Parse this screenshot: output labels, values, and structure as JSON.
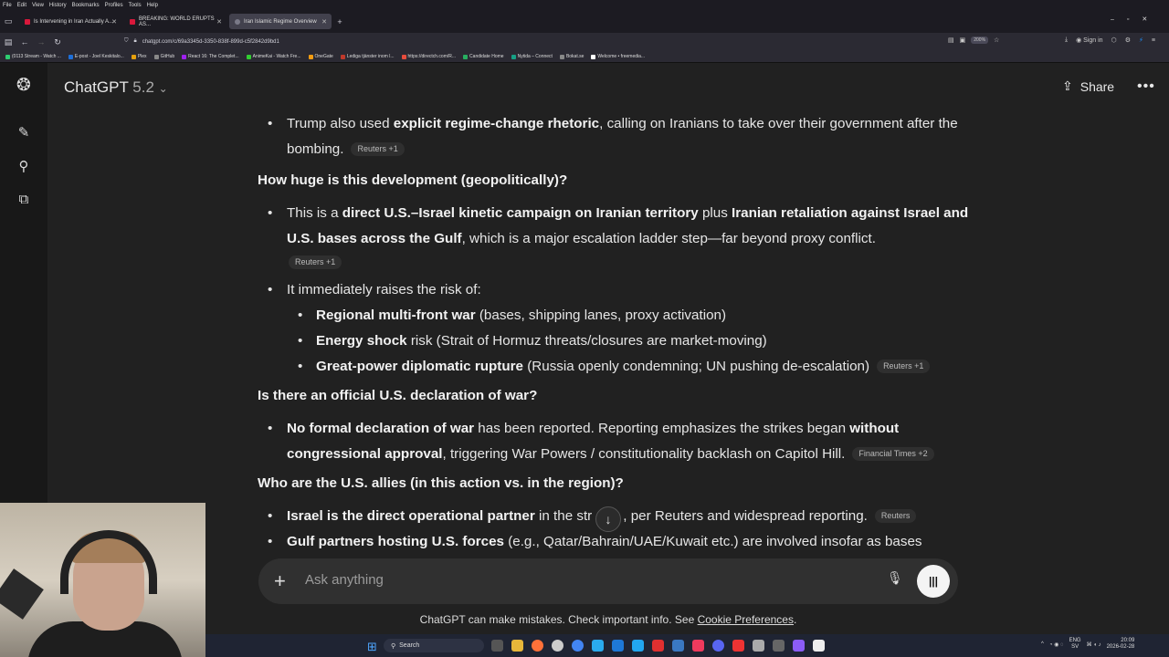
{
  "browser": {
    "menu": [
      "File",
      "Edit",
      "View",
      "History",
      "Bookmarks",
      "Profiles",
      "Tools",
      "Help"
    ],
    "tabs": [
      {
        "label": "Is Intervening in Iran Actually A...",
        "active": false
      },
      {
        "label": "BREAKING: WORLD ERUPTS AS...",
        "active": false
      },
      {
        "label": "Iran Islamic Regime Overview",
        "active": true
      }
    ],
    "url": "chatgpt.com/c/69a3345d-3350-838f-899d-c5f2842d9bd1",
    "zoom": "200%",
    "signin": "Sign in",
    "bookmarks": [
      "(0113 Stream - Watch ...",
      "E-post - Joel Keskitalo...",
      "Plex",
      "GitHub",
      "React 16: The Complet...",
      "AnimeKai - Watch Fre...",
      "OneGate",
      "Lediga tjänster inom l...",
      "https://directch.com/R...",
      "Candidate Home",
      "Nytida – Connect",
      "Bokat.se",
      "Welcome • freemedia..."
    ]
  },
  "header": {
    "model_name": "ChatGPT",
    "model_version": "5.2",
    "share_label": "Share",
    "more_label": "•••"
  },
  "content": {
    "p1_text_a": "Trump also used ",
    "p1_bold": "explicit regime-change rhetoric",
    "p1_text_b": ", calling on Iranians to take over their government after the bombing.",
    "p1_cite": "Reuters +1",
    "h1": "How huge is this development (geopolitically)?",
    "b1_a": "This is a ",
    "b1_bold1": "direct U.S.–Israel kinetic campaign on Iranian territory",
    "b1_b": " plus ",
    "b1_bold2": "Iranian retaliation against Israel and U.S. bases across the Gulf",
    "b1_c": ", which is a major escalation ladder step—far beyond proxy conflict.",
    "b1_cite": "Reuters +1",
    "b2": "It immediately raises the risk of:",
    "s1_bold": "Regional multi-front war",
    "s1_text": " (bases, shipping lanes, proxy activation)",
    "s2_bold": "Energy shock",
    "s2_text": " risk (Strait of Hormuz threats/closures are market-moving)",
    "s3_bold": "Great-power diplomatic rupture",
    "s3_text": " (Russia openly condemning; UN pushing de-escalation)",
    "s3_cite": "Reuters +1",
    "h2": "Is there an official U.S. declaration of war?",
    "b3_bold1": "No formal declaration of war",
    "b3_a": " has been reported. Reporting emphasizes the strikes began ",
    "b3_bold2": "without congressional approval",
    "b3_b": ", triggering War Powers / constitutionality backlash on Capitol Hill.",
    "b3_cite": "Financial Times +2",
    "h3": "Who are the U.S. allies (in this action vs. in the region)?",
    "b4_bold": "Israel is the direct operational partner",
    "b4_a": " in the str",
    "b4_b": ", per Reuters and widespread reporting.",
    "b4_cite": "Reuters",
    "b5_bold": "Gulf partners hosting U.S. forces",
    "b5_a": " (e.g., Qatar/Bahrain/UAE/Kuwait etc.) are involved insofar as bases"
  },
  "composer": {
    "placeholder": "Ask anything"
  },
  "footer": {
    "disclaimer": "ChatGPT can make mistakes. Check important info. See ",
    "link": "Cookie Preferences",
    "end": "."
  },
  "taskbar": {
    "search": "Search",
    "lang_top": "ENG",
    "lang_bottom": "SV",
    "time": "20:09",
    "date": "2026-02-28"
  }
}
